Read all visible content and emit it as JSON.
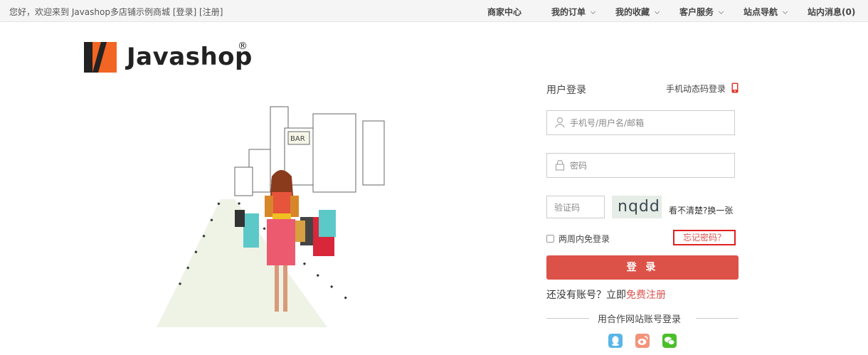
{
  "topbar": {
    "greeting": "您好，欢迎来到 Javashop多店铺示例商城",
    "login_link": "[登录]",
    "register_link": "[注册]",
    "nav": {
      "seller": "商家中心",
      "orders": "我的订单",
      "favorites": "我的收藏",
      "service": "客户服务",
      "site_nav": "站点导航",
      "messages": "站内消息(0)"
    }
  },
  "logo": {
    "text": "Javashop",
    "reg": "®"
  },
  "login": {
    "title": "用户登录",
    "sms_login": "手机动态码登录",
    "username_placeholder": "手机号/用户名/邮箱",
    "password_placeholder": "密码",
    "captcha_placeholder": "验证码",
    "captcha_text": "nqdd",
    "refresh_text": "看不清楚?换一张",
    "remember_label": "两周内免登录",
    "forgot_label": "忘记密码？",
    "submit_label": "登 录",
    "no_account_text": "还没有账号？立即",
    "free_register": "免费注册",
    "partner_title": "用合作网站账号登录"
  },
  "colors": {
    "accent": "#dd5248",
    "link_red": "#d9534f",
    "qq": "#5ab6e7",
    "weibo": "#f2937a",
    "wechat": "#4bbf2a",
    "logo_orange": "#f26522"
  }
}
